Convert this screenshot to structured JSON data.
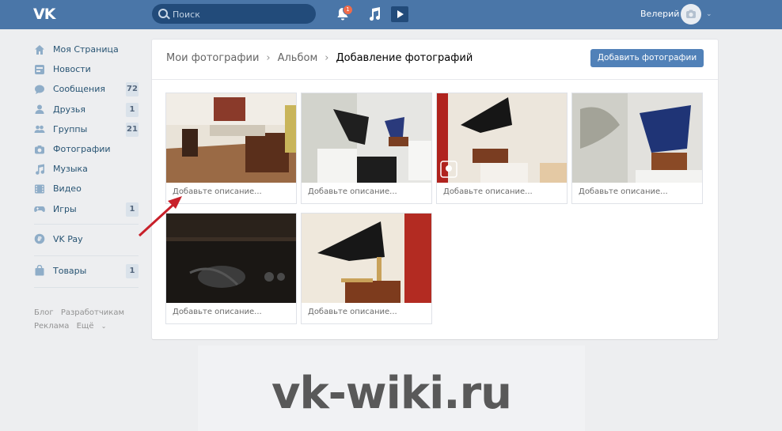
{
  "header": {
    "logo": "VK",
    "search_placeholder": "Поиск",
    "notification_count": "1",
    "user_name": "Велерий"
  },
  "sidebar": {
    "items": [
      {
        "label": "Моя Страница",
        "icon": "home-icon",
        "count": ""
      },
      {
        "label": "Новости",
        "icon": "news-icon",
        "count": ""
      },
      {
        "label": "Сообщения",
        "icon": "messages-icon",
        "count": "72"
      },
      {
        "label": "Друзья",
        "icon": "friend-icon",
        "count": "1"
      },
      {
        "label": "Группы",
        "icon": "groups-icon",
        "count": "21"
      },
      {
        "label": "Фотографии",
        "icon": "camera-icon",
        "count": ""
      },
      {
        "label": "Музыка",
        "icon": "music-icon",
        "count": ""
      },
      {
        "label": "Видео",
        "icon": "video-icon",
        "count": ""
      },
      {
        "label": "Игры",
        "icon": "gamepad-icon",
        "count": "1"
      }
    ],
    "vkpay": {
      "label": "VK Pay",
      "icon": "vkpay-icon"
    },
    "goods": {
      "label": "Товары",
      "icon": "bag-icon",
      "count": "1"
    },
    "footer_links": [
      "Блог",
      "Разработчикам",
      "Реклама",
      "Ещё"
    ]
  },
  "main": {
    "breadcrumbs": [
      "Мои фотографии",
      "Альбом",
      "Добавление фотографий"
    ],
    "add_button": "Добавить фотографии",
    "photos": [
      {
        "description_placeholder": "Добавьте описание..."
      },
      {
        "description_placeholder": "Добавьте описание..."
      },
      {
        "description_placeholder": "Добавьте описание..."
      },
      {
        "description_placeholder": "Добавьте описание..."
      },
      {
        "description_placeholder": "Добавьте описание..."
      },
      {
        "description_placeholder": "Добавьте описание..."
      }
    ]
  },
  "watermark": "vk-wiki.ru",
  "colors": {
    "header_bg": "#4a76a8",
    "link": "#285473",
    "button": "#5181b8",
    "annotation_arrow": "#c8202a"
  }
}
